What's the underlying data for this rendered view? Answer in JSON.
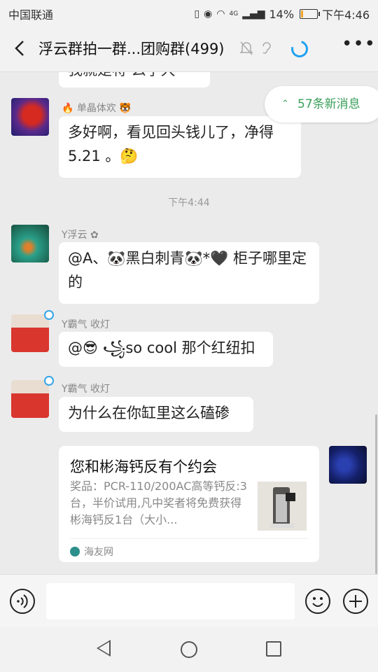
{
  "status_bar": {
    "carrier": "中国联通",
    "network_type": "4G",
    "battery_level": "14%",
    "battery_fraction": 0.14,
    "time": "下午4:46"
  },
  "header": {
    "title": "浮云群拍一群...团购群(499)"
  },
  "new_messages": {
    "label": "57条新消息"
  },
  "messages": [
    {
      "partial_text": "我就是将 么学大"
    },
    {
      "sender": "单晶体欢",
      "text": "多好啊，看见回头钱儿了，净得5.21 。🤔"
    },
    {
      "timestamp": "下午4:44"
    },
    {
      "sender": "Y浮云",
      "text": "@A、🐼黑白刺青🐼*🖤 柜子哪里定的"
    },
    {
      "sender": "Y霸气 收灯",
      "text": "@😎 ꧁so cool 那个红纽扣"
    },
    {
      "sender": "Y霸气 收灯",
      "text": "为什么在你缸里这么磕碜"
    }
  ],
  "share_card": {
    "title": "您和彬海钙反有个约会",
    "description": "奖品：PCR-110/200AC高等钙反:3台，半价试用,凡中奖者将免费获得彬海钙反1台（大小...",
    "source": "海友网"
  },
  "colors": {
    "accent_green": "#3a9f5a",
    "accent_blue": "#1ea1f1",
    "bubble": "#ffffff",
    "background": "#ebebeb"
  }
}
